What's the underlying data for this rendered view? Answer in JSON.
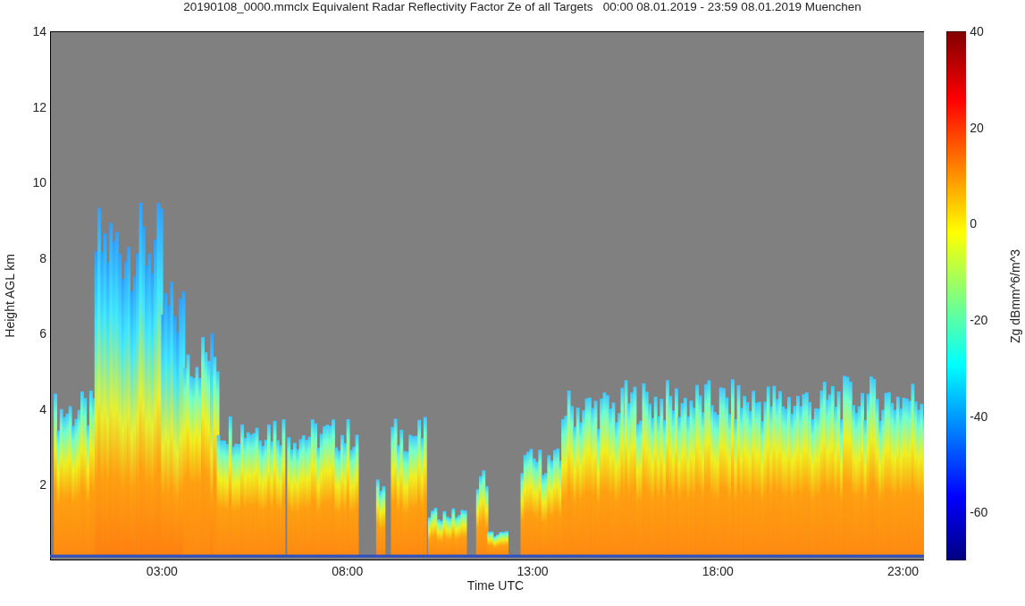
{
  "title": "20190108_0000.mmclx Equivalent Radar Reflectivity Factor Ze of all Targets   00:00 08.01.2019 - 23:59 08.01.2019 Muenchen",
  "y_axis": {
    "label": "Height AGL km",
    "ticks": [
      "14",
      "12",
      "10",
      "8",
      "6",
      "4",
      "2"
    ]
  },
  "x_axis": {
    "label": "Time UTC",
    "ticks": [
      "03:00",
      "08:00",
      "13:00",
      "18:00",
      "23:00"
    ]
  },
  "colorbar": {
    "label": "Zg dBmm^6/m^3",
    "ticks": [
      "40",
      "20",
      "0",
      "-20",
      "-40",
      "-60"
    ]
  }
}
